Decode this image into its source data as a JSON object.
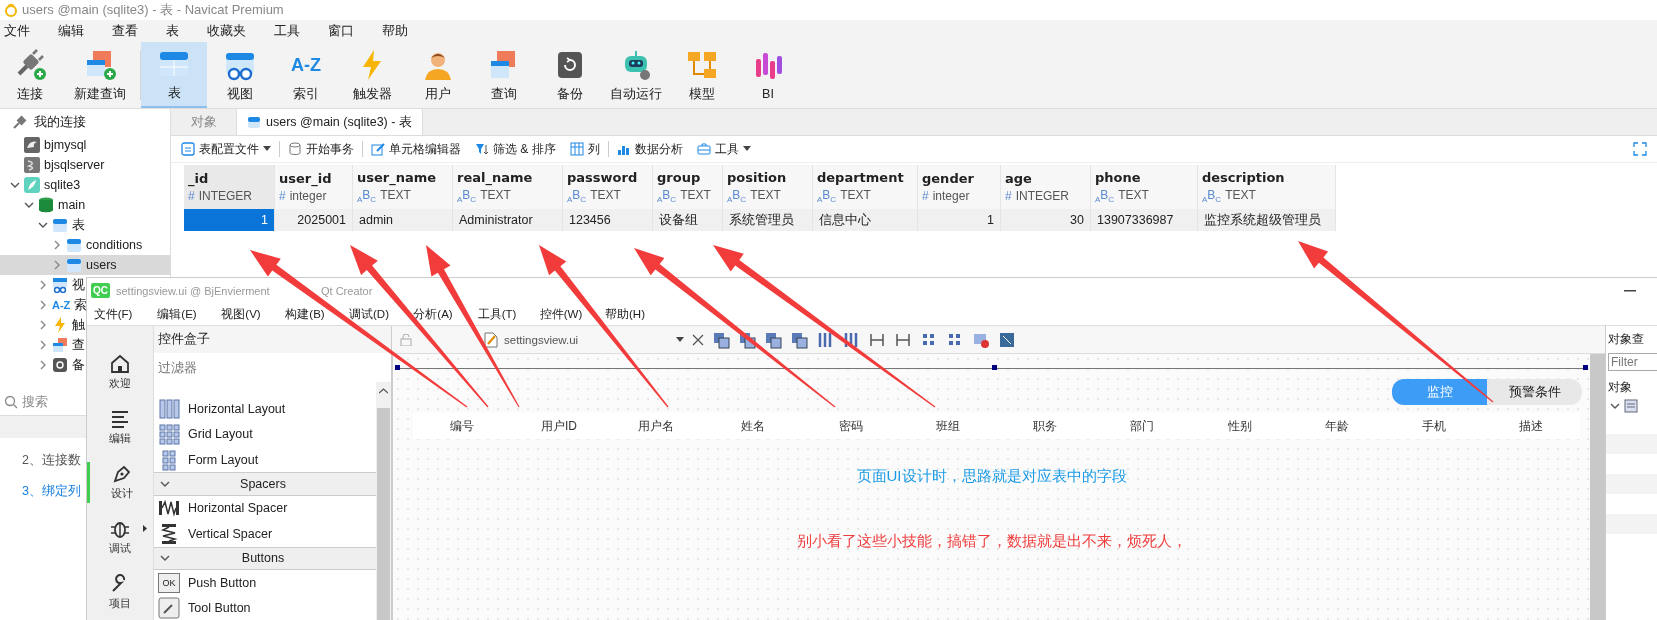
{
  "navicat": {
    "title": "users @main (sqlite3) - 表 - Navicat Premium",
    "menu": [
      "文件",
      "编辑",
      "查看",
      "表",
      "收藏夹",
      "工具",
      "窗口",
      "帮助"
    ],
    "toolbar": [
      {
        "label": "连接",
        "selected": false
      },
      {
        "label": "新建查询",
        "selected": false
      },
      {
        "label": "表",
        "selected": true
      },
      {
        "label": "视图",
        "selected": false
      },
      {
        "label": "索引",
        "selected": false,
        "glyph": "A-Z"
      },
      {
        "label": "触发器",
        "selected": false
      },
      {
        "label": "用户",
        "selected": false
      },
      {
        "label": "查询",
        "selected": false
      },
      {
        "label": "备份",
        "selected": false
      },
      {
        "label": "自动运行",
        "selected": false
      },
      {
        "label": "模型",
        "selected": false
      },
      {
        "label": "BI",
        "selected": false
      }
    ],
    "sidebar": {
      "header": "我的连接",
      "tree": [
        {
          "label": "bjmysql",
          "kind": "connection",
          "selected": false
        },
        {
          "label": "bjsqlserver",
          "kind": "connection",
          "selected": false
        },
        {
          "label": "sqlite3",
          "kind": "connection",
          "selected": false,
          "expanded": true,
          "children": [
            {
              "label": "main",
              "kind": "schema",
              "selected": false,
              "expanded": true,
              "children": [
                {
                  "label": "表",
                  "kind": "group",
                  "selected": false,
                  "expanded": true,
                  "children": [
                    {
                      "label": "conditions",
                      "kind": "table",
                      "selected": false,
                      "expanded": false
                    },
                    {
                      "label": "users",
                      "kind": "table",
                      "selected": true,
                      "expanded": false
                    }
                  ]
                },
                {
                  "label": "视",
                  "kind": "group",
                  "selected": false,
                  "expanded": false
                },
                {
                  "label": "索",
                  "kind": "group",
                  "selected": false,
                  "expanded": false,
                  "glyph": "A-Z"
                },
                {
                  "label": "触",
                  "kind": "group",
                  "selected": false,
                  "expanded": false
                },
                {
                  "label": "查",
                  "kind": "group",
                  "selected": false,
                  "expanded": false
                },
                {
                  "label": "备",
                  "kind": "group",
                  "selected": false,
                  "expanded": false
                }
              ]
            }
          ]
        }
      ],
      "search_placeholder": "搜索"
    },
    "notes": [
      {
        "text": "2、连接数",
        "color": "#555555"
      },
      {
        "text": "3、绑定列",
        "color": "#1a7fe0"
      }
    ],
    "tabs": [
      {
        "label": "对象",
        "selected": false
      },
      {
        "label": "users @main (sqlite3) - 表",
        "selected": true
      }
    ],
    "table_toolbar": [
      {
        "label": "表配置文件",
        "dropdown": true
      },
      {
        "label": "开始事务",
        "dropdown": false
      },
      {
        "label": "单元格编辑器",
        "dropdown": false
      },
      {
        "label": "筛选 & 排序",
        "dropdown": false
      },
      {
        "label": "列",
        "dropdown": false
      },
      {
        "label": "数据分析",
        "dropdown": false
      },
      {
        "label": "工具",
        "dropdown": true
      }
    ],
    "table": {
      "columns": [
        {
          "name": "_id",
          "type_mark": "#",
          "type": "INTEGER",
          "kind": "number"
        },
        {
          "name": "user_id",
          "type_mark": "#",
          "type": "integer",
          "kind": "number"
        },
        {
          "name": "user_name",
          "type_mark": "$_{A}$B$_{C}$",
          "type": "TEXT",
          "kind": "text"
        },
        {
          "name": "real_name",
          "type_mark": "$_{A}$B$_{C}$",
          "type": "TEXT",
          "kind": "text"
        },
        {
          "name": "password",
          "type_mark": "$_{A}$B$_{C}$",
          "type": "TEXT",
          "kind": "text"
        },
        {
          "name": "group",
          "type_mark": "$_{A}$B$_{C}$",
          "type": "TEXT",
          "kind": "text"
        },
        {
          "name": "position",
          "type_mark": "$_{A}$B$_{C}$",
          "type": "TEXT",
          "kind": "text"
        },
        {
          "name": "department",
          "type_mark": "$_{A}$B$_{C}$",
          "type": "TEXT",
          "kind": "text"
        },
        {
          "name": "gender",
          "type_mark": "#",
          "type": "integer",
          "kind": "number"
        },
        {
          "name": "age",
          "type_mark": "#",
          "type": "INTEGER",
          "kind": "number"
        },
        {
          "name": "phone",
          "type_mark": "$_{A}$B$_{C}$",
          "type": "TEXT",
          "kind": "text"
        },
        {
          "name": "description",
          "type_mark": "$_{A}$B$_{C}$",
          "type": "TEXT",
          "kind": "text"
        }
      ],
      "rows": [
        {
          "cells": [
            {
              "value": "1",
              "selected": true
            },
            {
              "value": "2025001",
              "selected": false
            },
            {
              "value": "admin",
              "selected": false
            },
            {
              "value": "Administrator",
              "selected": false
            },
            {
              "value": "123456",
              "selected": false
            },
            {
              "value": "设备组",
              "selected": false
            },
            {
              "value": "系统管理员",
              "selected": false
            },
            {
              "value": "信息中心",
              "selected": false
            },
            {
              "value": "1",
              "selected": false
            },
            {
              "value": "30",
              "selected": false
            },
            {
              "value": "13907336987",
              "selected": false
            },
            {
              "value": "监控系统超级管理员",
              "selected": false
            }
          ]
        }
      ]
    }
  },
  "qt_creator": {
    "title_parts": [
      "settingsview.ui @ BjEnvierment",
      "Qt Creator"
    ],
    "logo": "QC",
    "menu": [
      "文件(F)",
      "编辑(E)",
      "视图(V)",
      "构建(B)",
      "调试(D)",
      "分析(A)",
      "工具(T)",
      "控件(W)",
      "帮助(H)"
    ],
    "modes": [
      {
        "label": "欢迎",
        "selected": false
      },
      {
        "label": "编辑",
        "selected": false
      },
      {
        "label": "设计",
        "selected": true
      },
      {
        "label": "调试",
        "selected": false
      },
      {
        "label": "项目",
        "selected": false
      }
    ],
    "widget_box": {
      "title": "控件盒子",
      "filter_placeholder": "过滤器",
      "items": [
        {
          "kind": "item",
          "label": "Horizontal Layout"
        },
        {
          "kind": "item",
          "label": "Grid Layout"
        },
        {
          "kind": "item",
          "label": "Form Layout"
        },
        {
          "kind": "section",
          "label": "Spacers",
          "expanded": true
        },
        {
          "kind": "item",
          "label": "Horizontal Spacer"
        },
        {
          "kind": "item",
          "label": "Vertical Spacer"
        },
        {
          "kind": "section",
          "label": "Buttons",
          "expanded": true
        },
        {
          "kind": "item",
          "label": "Push Button",
          "glyph": "OK"
        },
        {
          "kind": "item",
          "label": "Tool Button"
        }
      ]
    },
    "editor": {
      "file": "settingsview.ui"
    },
    "form": {
      "tabs": [
        {
          "label": "监控",
          "selected": true
        },
        {
          "label": "预警条件",
          "selected": false
        }
      ],
      "columns": [
        "编号",
        "用户ID",
        "用户名",
        "姓名",
        "密码",
        "班组",
        "职务",
        "部门",
        "性别",
        "年龄",
        "手机",
        "描述"
      ],
      "notes": [
        {
          "text": "页面UI设计时，思路就是对应表中的字段",
          "color": "#1a9ae6"
        },
        {
          "text": "别小看了这些小技能，搞错了，数据就是出不来，烦死人，",
          "color": "#f03c3c"
        }
      ]
    },
    "object_inspector": {
      "title": "对象查",
      "filter_placeholder": "Filter",
      "label": "对象"
    }
  }
}
